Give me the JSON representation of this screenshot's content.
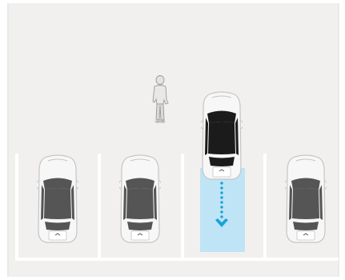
{
  "scene": {
    "icons": {
      "pedestrian": "pedestrian-icon",
      "reversing_car": "reversing-car-icon",
      "parked_car": "parked-car-icon",
      "reverse_arrow": "reverse-path-arrow-icon"
    },
    "colors": {
      "ground": "#f2f0ee",
      "frame_border": "#e9e9e9",
      "bay_line": "#ffffff",
      "bay_highlight": "#bfe4f5",
      "arrow": "#1aa3d9",
      "car_body": "#f7f7f7",
      "car_outline": "#c5c5c5",
      "car_glass": "#555555",
      "car_dark": "#1b1b1b"
    },
    "parked_car_count": 3,
    "reverse_direction": "down"
  }
}
